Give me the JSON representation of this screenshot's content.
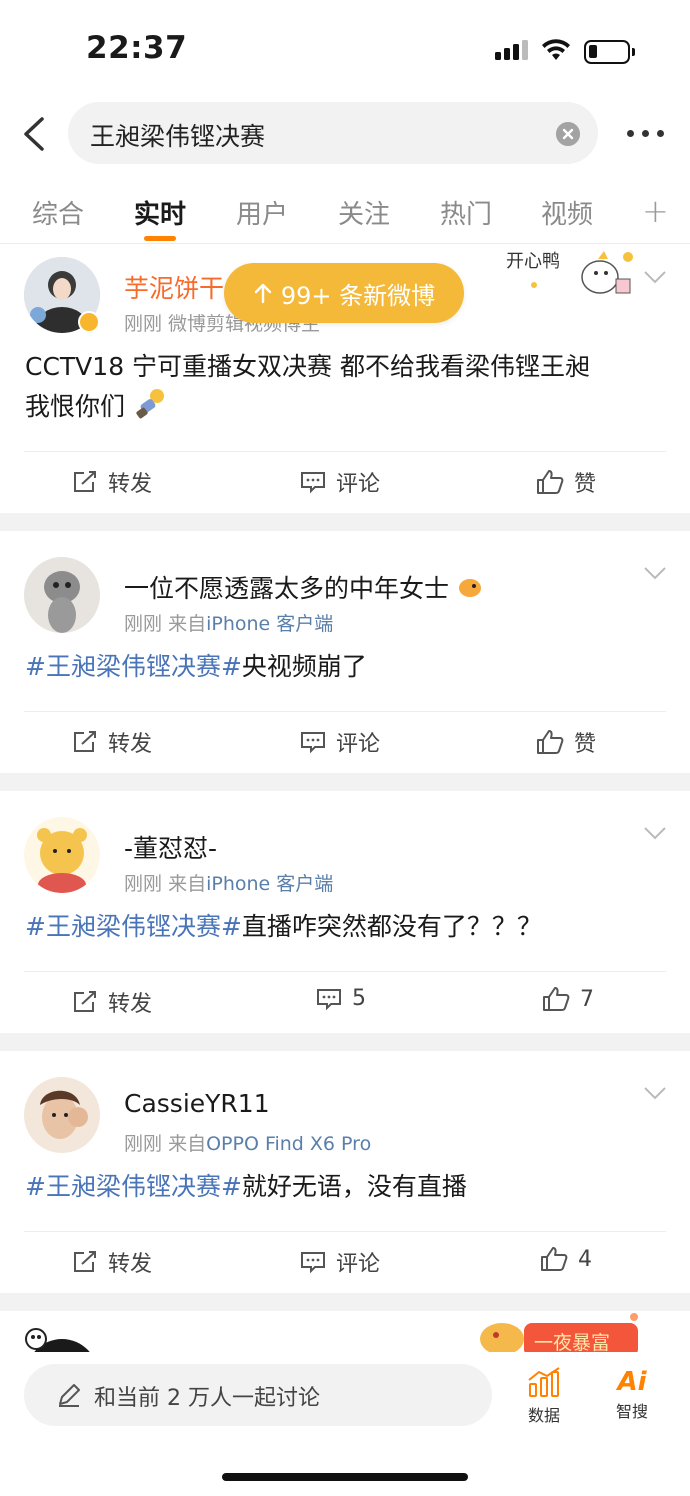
{
  "status": {
    "time": "22:37"
  },
  "search": {
    "query": "王昶梁伟铿决赛"
  },
  "tabs": [
    {
      "label": "综合"
    },
    {
      "label": "实时"
    },
    {
      "label": "用户"
    },
    {
      "label": "关注"
    },
    {
      "label": "热门"
    },
    {
      "label": "视频"
    }
  ],
  "new_posts": {
    "label": "99+ 条新微博"
  },
  "posts": [
    {
      "name": "芋泥饼干",
      "meta": "刚刚  微博剪辑视频博主",
      "content_line1": "CCTV18 宁可重播女双决赛 都不给我看梁伟铿王昶",
      "content_line2": "我恨你们",
      "repost": "转发",
      "comment": "评论",
      "like": "赞",
      "sticker_text": "开心鸭"
    },
    {
      "name": "一位不愿透露太多的中年女士",
      "meta_time": "刚刚",
      "meta_from": "来自",
      "meta_source": "iPhone 客户端",
      "topic": "#王昶梁伟铿决赛#",
      "text": "央视频崩了",
      "repost": "转发",
      "comment": "评论",
      "like": "赞"
    },
    {
      "name": "-董怼怼-",
      "meta_time": "刚刚",
      "meta_from": "来自",
      "meta_source": "iPhone 客户端",
      "topic": "#王昶梁伟铿决赛#",
      "text": "直播咋突然都没有了？？？",
      "repost": "转发",
      "comment": "5",
      "like": "7"
    },
    {
      "name": "CassieYR11",
      "meta_time": "刚刚",
      "meta_from": "来自",
      "meta_source": "OPPO Find X6 Pro",
      "topic": "#王昶梁伟铿决赛#",
      "text": "就好无语，没有直播",
      "repost": "转发",
      "comment": "评论",
      "like": "4"
    }
  ],
  "bottom": {
    "discuss_placeholder": "和当前 2 万人一起讨论",
    "data_label": "数据",
    "ai_label": "智搜",
    "ai_icon_text": "Ai",
    "banner_text": "一夜暴富"
  },
  "colors": {
    "accent": "#ff8200",
    "topic": "#4a74b8",
    "pill": "#f5b93a"
  }
}
